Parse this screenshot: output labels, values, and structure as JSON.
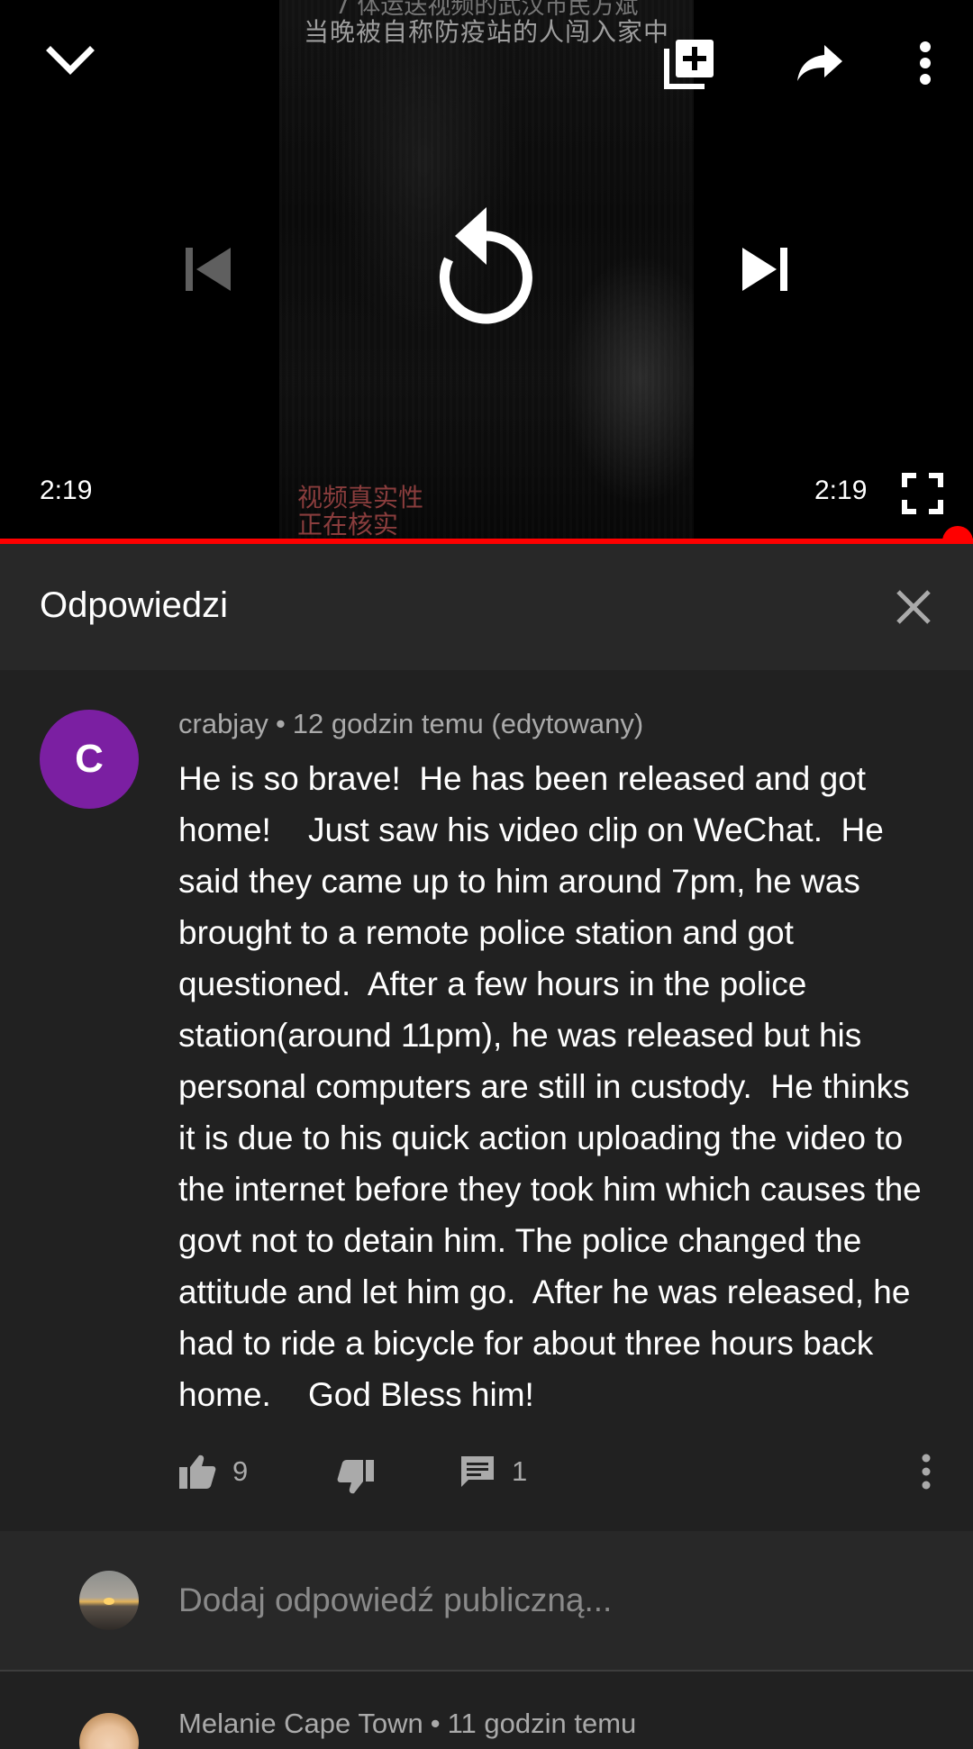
{
  "player": {
    "overlay_text_top": "7 体运送视频的武汉市民方斌",
    "overlay_text": "当晚被自称防疫站的人闯入家中",
    "watermark_line1": "视频真实性",
    "watermark_line2": "正在核实",
    "current_time": "2:19",
    "duration": "2:19",
    "progress": 1.0,
    "icons": {
      "minimize": "chevron-down-icon",
      "add_to_playlist": "playlist-add-icon",
      "share": "share-icon",
      "more": "more-vert-icon",
      "previous": "skip-previous-icon",
      "replay": "replay-icon",
      "next": "skip-next-icon",
      "fullscreen": "fullscreen-icon"
    },
    "accent_color": "#ff0000"
  },
  "replies_panel": {
    "title": "Odpowiedzi",
    "close_icon": "close-icon"
  },
  "comment": {
    "avatar_letter": "C",
    "avatar_color": "#7b1fa2",
    "author": "crabjay",
    "timestamp": "12 godzin temu (edytowany)",
    "text": "He is so brave!  He has been released and got home!    Just saw his video clip on WeChat.  He said they came up to him around 7pm, he was brought to a remote police station and got questioned.  After a few hours in the police station(around 11pm), he was released but his personal computers are still in custody.  He thinks it is due to his quick action uploading the video to the internet before they took him which causes the govt not to detain him. The police changed the attitude and let him go.  After he was released, he had to ride a bicycle for about three hours back home.    God Bless him!",
    "likes": "9",
    "replies": "1"
  },
  "reply_input": {
    "placeholder": "Dodaj odpowiedź publiczną..."
  },
  "next_comment": {
    "author": "Melanie Cape Town",
    "timestamp": "11 godzin temu"
  }
}
